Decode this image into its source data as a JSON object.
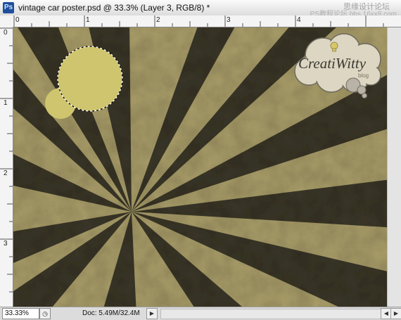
{
  "window": {
    "title": "vintage car poster.psd @ 33.3% (Layer 3, RGB/8) *",
    "app_icon_label": "Ps"
  },
  "watermark": {
    "line1": "思缘设计论坛",
    "line2": "PS教程论坛 bbs.16xx8.com"
  },
  "ruler": {
    "top_labels": [
      "0",
      "1",
      "2",
      "3",
      "4"
    ],
    "left_labels": [
      "0",
      "1",
      "2",
      "3"
    ]
  },
  "canvas": {
    "background_color": "#a99d69",
    "ray_color": "#3a3628",
    "circle_color": "#cfc56e",
    "logo_text": "CreatiWitty",
    "logo_sub": "blog"
  },
  "status": {
    "zoom": "33.33%",
    "doc_info": "Doc: 5.49M/32.4M",
    "arrow_label": "▶",
    "left_arrow": "◀",
    "right_arrow": "▶"
  }
}
